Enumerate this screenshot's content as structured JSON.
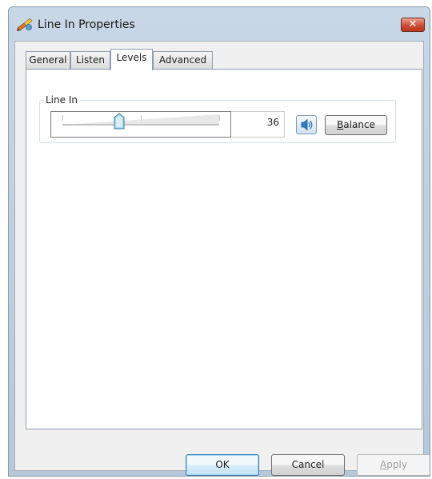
{
  "window": {
    "title": "Line In Properties",
    "title_icon": "speaker-pen-icon",
    "close_label": "✕"
  },
  "tabs": [
    {
      "label": "General",
      "selected": false
    },
    {
      "label": "Listen",
      "selected": false
    },
    {
      "label": "Levels",
      "selected": true
    },
    {
      "label": "Advanced",
      "selected": false
    }
  ],
  "levels": {
    "group_label": "Line In",
    "value": "36",
    "slider_fraction": 0.36,
    "mute_icon": "speaker-icon",
    "balance": {
      "prefix": "",
      "mnemonic": "B",
      "rest": "alance"
    }
  },
  "footer": {
    "ok_label": "OK",
    "cancel_label": "Cancel",
    "apply": {
      "mnemonic": "A",
      "rest": "pply",
      "disabled": true
    }
  },
  "colors": {
    "title_gradient_top": "#c8d7e6",
    "close_red": "#cf4b32",
    "thumb_blue": "#a9d6ee"
  }
}
